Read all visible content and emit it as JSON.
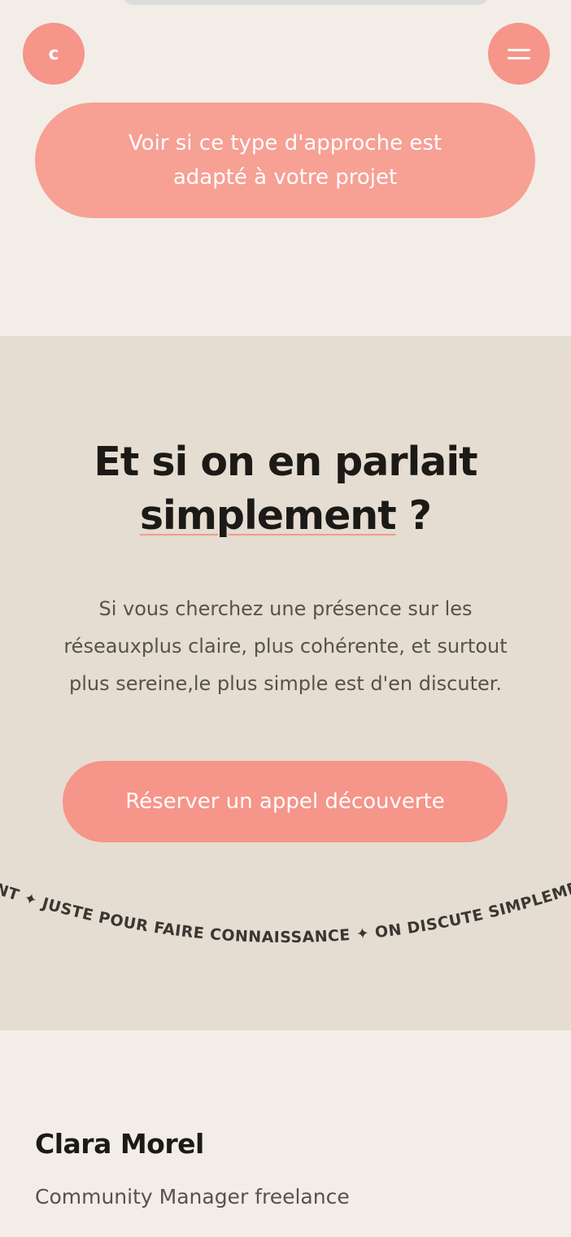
{
  "header": {
    "logo_letter": "c",
    "menu_icon": "hamburger-icon"
  },
  "approach_cta": {
    "label": "Voir si ce type d'approche est adapté à votre projet"
  },
  "cta_section": {
    "headline_line1": "Et si on en parlait",
    "headline_underlined": "simplement",
    "headline_suffix": " ?",
    "paragraph": "Si vous cherchez une présence sur les réseauxplus claire, plus cohérente, et surtout plus sereine,le plus simple est d'en discuter.",
    "button_label": "Réserver un appel découverte",
    "marquee_text": "ENT ✦ JUSTE POUR FAIRE CONNAISSANCE ✦ ON DISCUTE SIMPLEMENT"
  },
  "footer": {
    "name": "Clara Morel",
    "role": "Community Manager freelance"
  },
  "colors": {
    "background": "#f2eee7",
    "section_background": "#e5ddd1",
    "accent": "#f6958a",
    "text_dark": "#1c1a17",
    "text_muted": "#56524c"
  }
}
